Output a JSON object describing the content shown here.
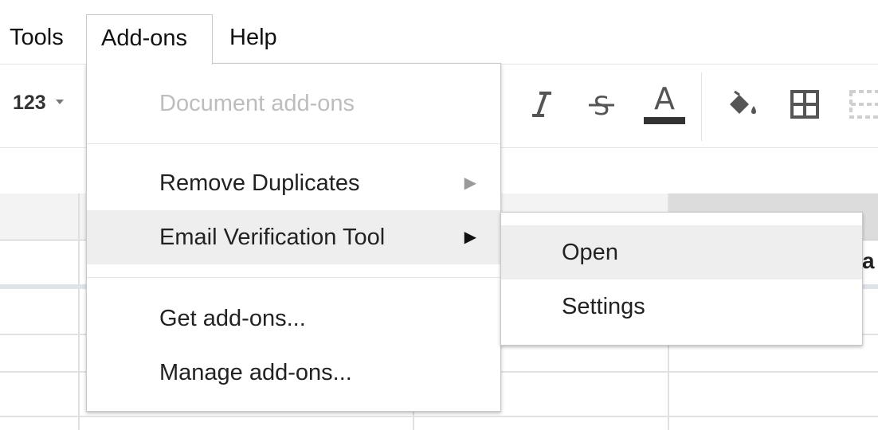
{
  "menubar": {
    "items": [
      {
        "label": "Tools"
      },
      {
        "label": "Add-ons"
      },
      {
        "label": "Help"
      }
    ]
  },
  "toolbar": {
    "number_format_label": "123",
    "icons": [
      "italic-icon",
      "strikethrough-icon",
      "text-color-icon",
      "fill-color-icon",
      "borders-icon",
      "merge-cells-icon"
    ],
    "text_color_bar": "#333333"
  },
  "addons_menu": {
    "header": "Document add-ons",
    "items": [
      {
        "label": "Remove Duplicates",
        "has_submenu": true
      },
      {
        "label": "Email Verification Tool",
        "has_submenu": true,
        "highlighted": true
      },
      {
        "label": "Get add-ons..."
      },
      {
        "label": "Manage add-ons..."
      }
    ],
    "submenu_arrow": "▶"
  },
  "email_submenu": {
    "items": [
      {
        "label": "Open",
        "highlighted": true
      },
      {
        "label": "Settings"
      }
    ]
  },
  "sheet": {
    "partial_cell_text": "a"
  }
}
